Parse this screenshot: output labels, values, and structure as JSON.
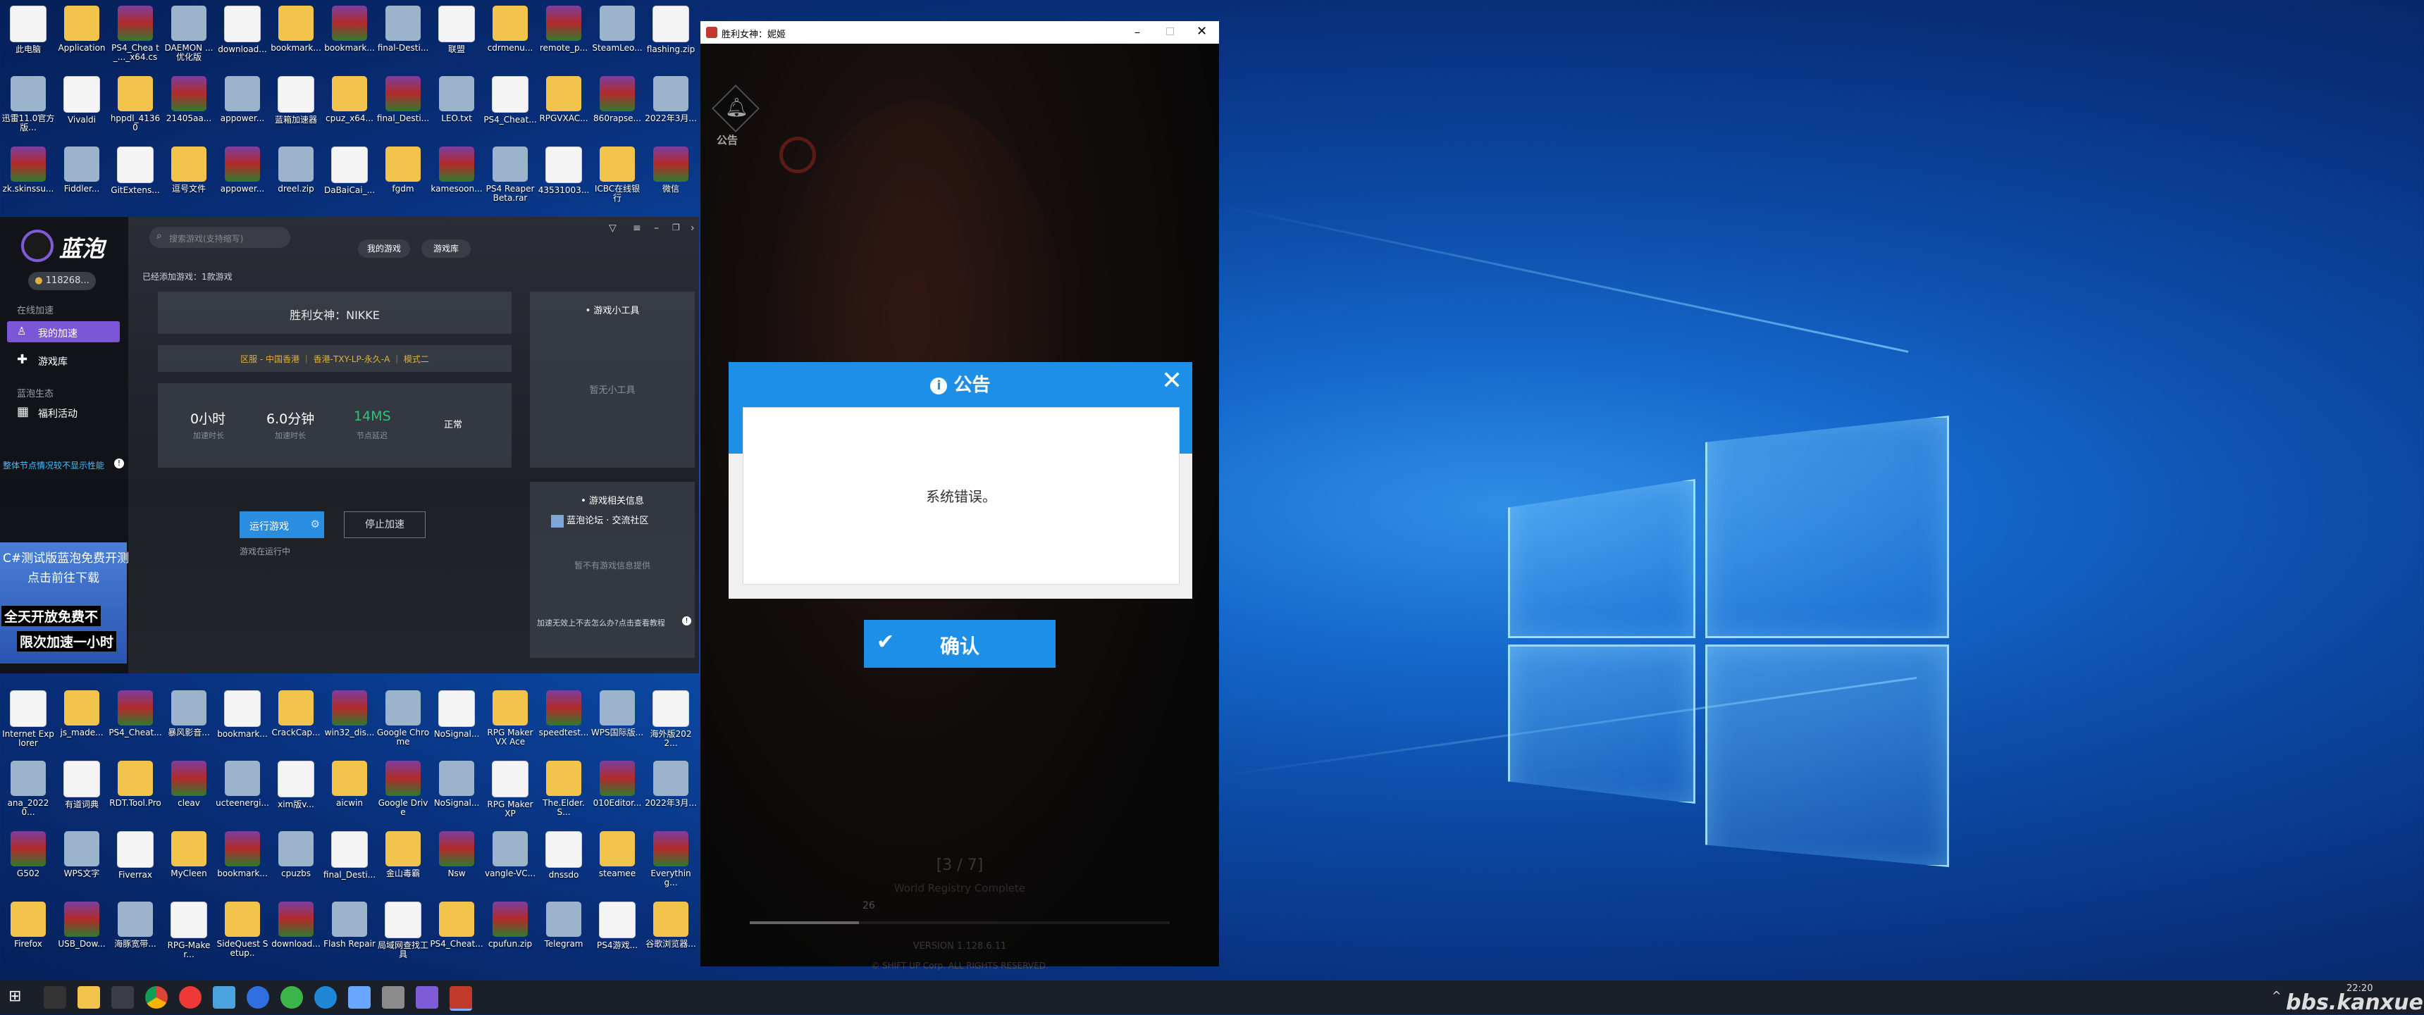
{
  "desktop_icons": {
    "row1": [
      "此电脑",
      "Application",
      "PS4_Chea t_..._x64.cs",
      "DAEMON ...优化版",
      "download...",
      "bookmark...",
      "bookmark...",
      "final-Desti...",
      "联盟",
      "cdrmenu...",
      "remote_p...",
      "SteamLeo...",
      "flashing.zip"
    ],
    "row2": [
      "迅雷11.0官方版...",
      "Vivaldi",
      "hppdl_41360",
      "21405aa...",
      "appower...",
      "蓝箱加速器",
      "cpuz_x64...",
      "final_Desti...",
      "LEO.txt",
      "PS4_Cheat...",
      "RPGVXAC...",
      "860rapse...",
      "2022年3月..."
    ],
    "row3": [
      "zk.skinssu...",
      "Fiddler...",
      "GitExtens...",
      "逗号文件",
      "appower...",
      "dreel.zip",
      "DaBaiCai_...",
      "fgdm",
      "kamesoon...",
      "PS4 Reaper Beta.rar",
      "43531003...",
      "ICBC在线银行",
      "微信"
    ],
    "lower1": [
      "Internet Explorer",
      "js_made...",
      "PS4_Cheat...",
      "暴风影音...",
      "bookmark...",
      "CrackCap...",
      "win32_dis...",
      "Google Chrome",
      "NoSignal...",
      "RPG Maker VX Ace",
      "speedtest...",
      "WPS国际版...",
      "海外版2022..."
    ],
    "lower2": [
      "ana_20220...",
      "有道词典",
      "RDT.Tool.Pro",
      "cleav",
      "ucteenergi...",
      "xim版v...",
      "aicwin",
      "Google Drive",
      "NoSignal...",
      "RPG Maker XP",
      "The.Elder.S...",
      "010Editor...",
      "2022年3月..."
    ],
    "lower3": [
      "G502",
      "WPS文字",
      "Fiverrax",
      "MyCleen",
      "bookmark...",
      "cpuzbs",
      "final_Desti...",
      "金山毒霸",
      "Nsw",
      "vangle-VC...",
      "dnssdo",
      "steamee",
      "Everything..."
    ],
    "lower4": [
      "Firefox",
      "USB_Dow...",
      "海豚宽带...",
      "RPG-Maker...",
      "SideQuest Setup..",
      "download...",
      "Flash Repair",
      "局域网查找工具",
      "PS4_Cheat...",
      "cpufun.zip",
      "Telegram",
      "PS4游戏...",
      "谷歌浏览器..."
    ]
  },
  "launcher": {
    "brand": "蓝泡",
    "user": "118268...",
    "nav_group1": "在线加速",
    "nav_my_accel": "我的加速",
    "nav_library": "游戏库",
    "nav_group2": "蓝泡生态",
    "nav_welfare": "福利活动",
    "notice_link": "整体节点情况较不显示性能",
    "ad1": "C#测试版蓝泡免费开测",
    "ad2": "点击前往下载",
    "ad3": "全天开放免费不",
    "ad4": "限次加速一小时",
    "search_placeholder": "搜索游戏(支持缩写)",
    "tab_my": "我的游戏",
    "tab_lib": "游戏库",
    "added_count": "已经添加游戏：1款游戏",
    "game_name": "胜利女神：NIKKE",
    "route": "区服 - 中国香港 ｜ 香港-TXY-LP-永久-A ｜ 模式二",
    "stat1_val": "0小时",
    "stat1_lbl": "加速时长",
    "stat2_val": "6.0分钟",
    "stat2_lbl": "加速时长",
    "stat3_val": "14MS",
    "stat3_lbl": "节点延迟",
    "stat4_val": "正常",
    "run_btn": "运行游戏",
    "stop_btn": "停止加速",
    "running": "游戏在运行中",
    "tools_title": "• 游戏小工具",
    "tools_empty": "暂无小工具",
    "info_title": "• 游戏相关信息",
    "info_item": "蓝泡论坛 · 交流社区",
    "info_empty": "暂不有游戏信息提供",
    "help_link": "加速无效上不去怎么办?点击查看教程",
    "colors": {
      "accent": "#2b8de0",
      "green": "#2ec27e",
      "gold": "#e0b040"
    }
  },
  "game_window": {
    "title": "胜利女神：妮姬",
    "announcement_label": "公告",
    "dialog_title": "公告",
    "dialog_message": "系统错误。",
    "confirm": "确认",
    "page": "[3 / 7]",
    "subtext": "World Registry Complete",
    "progress_num": "26",
    "progress": 0.26,
    "version": "VERSION   1.128.6.11",
    "copyright": "© SHIFT UP Corp. ALL RIGHTS RESERVED.",
    "colors": {
      "accent": "#1e8fe6"
    }
  },
  "taskbar": {
    "clock_time": "22:20",
    "watermark": "bbs.kanxue.net"
  }
}
